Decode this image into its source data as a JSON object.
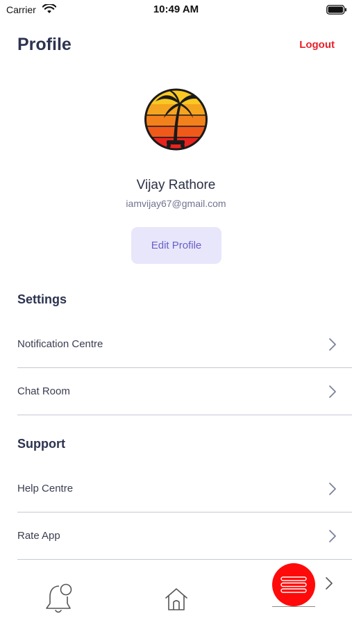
{
  "status_bar": {
    "carrier": "Carrier",
    "time": "10:49 AM"
  },
  "header": {
    "title": "Profile",
    "logout_label": "Logout"
  },
  "profile": {
    "name": "Vijay Rathore",
    "email": "iamvijay67@gmail.com",
    "edit_label": "Edit Profile"
  },
  "sections": {
    "settings": {
      "title": "Settings",
      "items": [
        {
          "label": "Notification Centre"
        },
        {
          "label": "Chat Room"
        }
      ]
    },
    "support": {
      "title": "Support",
      "items": [
        {
          "label": "Help Centre"
        },
        {
          "label": "Rate App"
        }
      ]
    }
  },
  "tab_bar": {
    "icons": [
      "bell-icon",
      "home-icon",
      "menu-icon"
    ]
  },
  "colors": {
    "accent_red": "#e8202a",
    "fab_red": "#ff0a0a",
    "edit_bg": "#e8e6fb",
    "edit_text": "#6860c9",
    "title_text": "#2d3350"
  }
}
